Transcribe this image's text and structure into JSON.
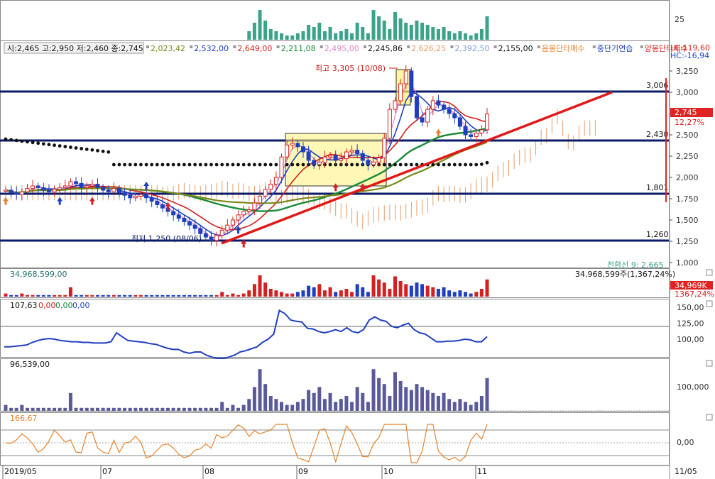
{
  "colors": {
    "up": "#d42020",
    "down": "#1f3fbf",
    "navy": "#0b1a66",
    "bg": "#ffffff",
    "axis": "#444444",
    "cloud_up": "#e79a66",
    "cloud_dn": "#7f9fd8",
    "teal": "#3aa38a",
    "purple": "#5a5a9a",
    "orange": "#e3822a"
  },
  "top_panel": {
    "axis_label": "25"
  },
  "header": {
    "ohlc": "시:2,465 고:2,950 저:2,460 종:2,745",
    "ma_values": [
      {
        "text": "2,023,42",
        "color": "#7a8a1a"
      },
      {
        "text": "2,532,00",
        "color": "#1f3fbf"
      },
      {
        "text": "2,649,00",
        "color": "#d42020"
      },
      {
        "text": "2,211,08",
        "color": "#1a8a3a"
      },
      {
        "text": "2,495,00",
        "color": "#e087c8"
      },
      {
        "text": "2,245,86",
        "color": "#111111"
      },
      {
        "text": "2,626,25",
        "color": "#e79a66"
      },
      {
        "text": "2,392,50",
        "color": "#7f9fd8"
      },
      {
        "text": "2,155,00",
        "color": "#111111"
      }
    ],
    "signals": [
      {
        "text": "음봉단타매수",
        "color": "#e3822a"
      },
      {
        "text": "중단기연습",
        "color": "#1f3fbf"
      },
      {
        "text": "양봉단타매수",
        "color": "#d42020"
      }
    ],
    "lc": "LC:119,60",
    "hc": "HC:-16,94"
  },
  "annotations": {
    "high": "최고 3,305 (10/08)",
    "low": "최저 1,250 (08/06)",
    "level_3006": "3,006",
    "level_2430": "2,430",
    "level_1801": "1,801",
    "level_1260": "1,260",
    "bottom_cut": "전환선 9: 2,665"
  },
  "price_axis": [
    "3,250",
    "3,000",
    "2,750",
    "2,500",
    "2,250",
    "2,000",
    "1,750",
    "1,500",
    "1,250",
    "1,000"
  ],
  "price_badge": {
    "price": "2,745",
    "pct": "12,27%"
  },
  "volume_panel": {
    "label_left": "34,968,599,00",
    "label_right": "34,968,599주(1,367,24%)",
    "badge_value": "34,969K",
    "badge_pct": "1367,24%"
  },
  "indicator1": {
    "label": "107,63",
    "label2": "0,00",
    "label3": "0,00",
    "label4": "0,00",
    "axis": [
      "150,00",
      "125,00",
      "100,00"
    ]
  },
  "indicator2": {
    "label": "96,539,00",
    "axis": [
      "100,000"
    ]
  },
  "indicator3": {
    "label": "166,67",
    "axis": [
      "0,00"
    ]
  },
  "date_axis": {
    "labels": [
      "2019/05",
      "07",
      "08",
      "09",
      "10",
      "11"
    ],
    "right": "11/05"
  },
  "chart_data": {
    "type": "candlestick",
    "title": "",
    "y_range": [
      1000,
      3300
    ],
    "horizontal_levels": [
      3006,
      2430,
      1801,
      1260
    ],
    "high": {
      "value": 3305,
      "date": "10/08"
    },
    "low": {
      "value": 1250,
      "date": "08/06"
    },
    "last_close": 2745,
    "candles_close_approx": [
      1850,
      1820,
      1800,
      1830,
      1870,
      1900,
      1880,
      1850,
      1830,
      1860,
      1880,
      1900,
      1950,
      1930,
      1880,
      1900,
      1920,
      1880,
      1850,
      1830,
      1870,
      1820,
      1790,
      1760,
      1780,
      1800,
      1760,
      1720,
      1680,
      1640,
      1600,
      1560,
      1520,
      1480,
      1440,
      1400,
      1340,
      1300,
      1260,
      1320,
      1380,
      1440,
      1500,
      1560,
      1600,
      1620,
      1700,
      1780,
      1860,
      1920,
      2000,
      2240,
      2380,
      2400,
      2360,
      2300,
      2200,
      2150,
      2180,
      2240,
      2260,
      2200,
      2220,
      2300,
      2320,
      2280,
      2200,
      2150,
      2180,
      2230,
      2460,
      2800,
      2900,
      3100,
      3250,
      2950,
      2700,
      2650,
      2800,
      2900,
      2850,
      2800,
      2750,
      2700,
      2600,
      2500,
      2480,
      2520,
      2560,
      2745
    ],
    "volume_approx": [
      2,
      1,
      1,
      2,
      1,
      1,
      1,
      1,
      1,
      1,
      1,
      1,
      6,
      1,
      1,
      1,
      1,
      1,
      1,
      1,
      1,
      1,
      1,
      1,
      1,
      1,
      1,
      1,
      1,
      1,
      1,
      1,
      1,
      1,
      1,
      1,
      1,
      1,
      1,
      1,
      3,
      1,
      2,
      1,
      2,
      4,
      8,
      14,
      9,
      5,
      4,
      3,
      2,
      2,
      3,
      4,
      7,
      6,
      8,
      4,
      6,
      3,
      4,
      5,
      3,
      8,
      6,
      3,
      14,
      11,
      9,
      5,
      13,
      10,
      8,
      7,
      9,
      8,
      7,
      6,
      5,
      6,
      4,
      3,
      4,
      3,
      2,
      3,
      5,
      11
    ],
    "indicator1_series": [
      88,
      88,
      89,
      90,
      91,
      95,
      98,
      100,
      101,
      100,
      98,
      97,
      96,
      96,
      95,
      95,
      94,
      94,
      94,
      96,
      110,
      104,
      98,
      97,
      96,
      95,
      93,
      92,
      89,
      86,
      84,
      84,
      80,
      78,
      80,
      80,
      75,
      72,
      70,
      70,
      72,
      75,
      80,
      82,
      85,
      88,
      95,
      100,
      108,
      145,
      140,
      130,
      128,
      127,
      117,
      116,
      112,
      110,
      112,
      115,
      112,
      118,
      112,
      110,
      115,
      130,
      135,
      130,
      128,
      120,
      118,
      122,
      125,
      115,
      110,
      108,
      102,
      96,
      96,
      97,
      97,
      98,
      100,
      99,
      96,
      96,
      104
    ]
  }
}
